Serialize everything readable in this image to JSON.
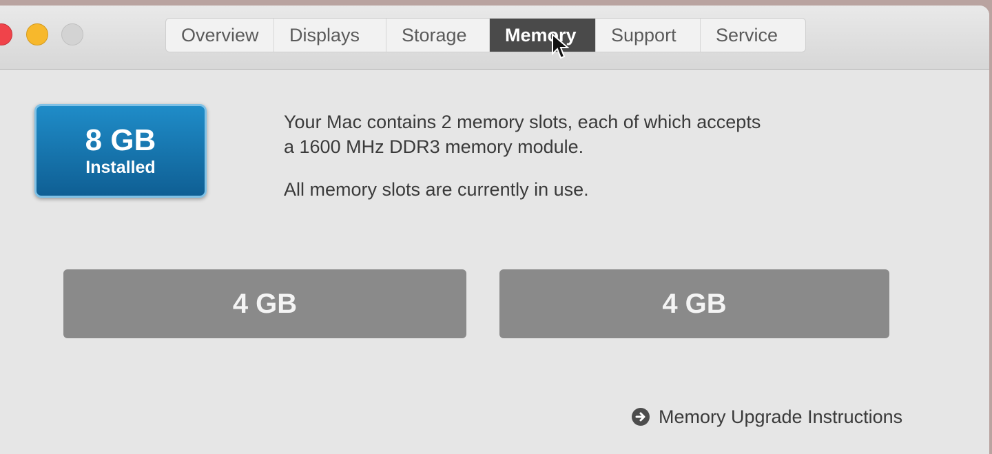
{
  "window": {
    "tabs": [
      {
        "label": "Overview"
      },
      {
        "label": "Displays"
      },
      {
        "label": "Storage"
      },
      {
        "label": "Memory"
      },
      {
        "label": "Support"
      },
      {
        "label": "Service"
      }
    ],
    "active_tab": "Memory"
  },
  "summary": {
    "size": "8 GB",
    "label": "Installed",
    "accent_color": "#1677b3"
  },
  "description": {
    "line1": "Your Mac contains 2 memory slots, each of which accepts",
    "line2": "a 1600 MHz DDR3 memory module.",
    "status": "All memory slots are currently in use."
  },
  "slots": [
    {
      "size": "4 GB"
    },
    {
      "size": "4 GB"
    }
  ],
  "upgrade_link": {
    "label": "Memory Upgrade Instructions",
    "icon": "arrow-right-circle-icon"
  },
  "icons": {
    "cursor": "pointer-cursor-icon"
  }
}
